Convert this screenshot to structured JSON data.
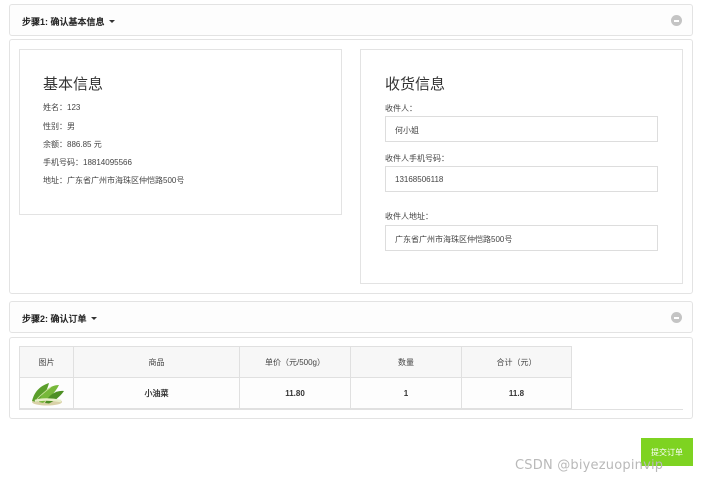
{
  "step1": {
    "title": "步骤1: 确认基本信息",
    "basic_info": {
      "heading": "基本信息",
      "lines": [
        "姓名：123",
        "性别：男",
        "余额：886.85 元",
        "手机号码：18814095566",
        "地址：广东省广州市海珠区仲恺路500号"
      ]
    },
    "shipping_info": {
      "heading": "收货信息",
      "recipient_label": "收件人：",
      "recipient_value": "何小姐",
      "phone_label": "收件人手机号码：",
      "phone_value": "13168506118",
      "address_label": "收件人地址：",
      "address_value": "广东省广州市海珠区仲恺路500号"
    }
  },
  "step2": {
    "title": "步骤2: 确认订单",
    "table": {
      "headers": [
        "图片",
        "商品",
        "单价（元/500g）",
        "数量",
        "合计（元）"
      ],
      "rows": [
        {
          "image_icon": "bok-choy-image",
          "product": "小油菜",
          "unit_price": "11.80",
          "quantity": "1",
          "total": "11.8"
        }
      ]
    }
  },
  "submit_label": "提交订单",
  "watermark": "CSDN @biyezuopinvip",
  "colors": {
    "accent_green": "#7ed321",
    "border": "#e3e3e3"
  }
}
